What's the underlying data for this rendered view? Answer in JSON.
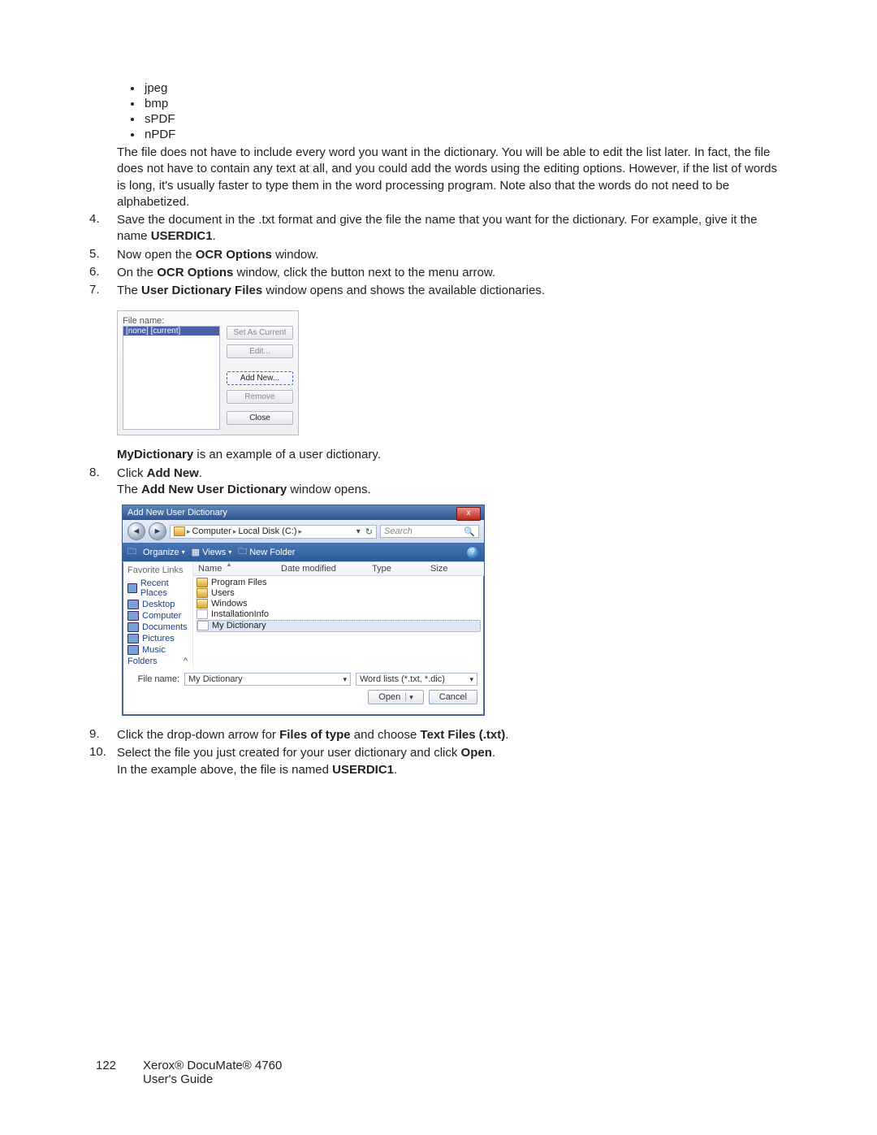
{
  "bullets": {
    "b0": "jpeg",
    "b1": "bmp",
    "b2": "sPDF",
    "b3": "nPDF"
  },
  "para1": "The file does not have to include every word you want in the dictionary. You will be able to edit the list later. In fact, the file does not have to contain any text at all, and you could add the words using the editing options. However, if the list of words is long, it's usually faster to type them in the word processing program. Note also that the words do not need to be alphabetized.",
  "step4_num": "4.",
  "step4_a": "Save the document in the .txt format and give the file the name that you want for the dictionary. For example, give it the name ",
  "step4_b": "USERDIC1",
  "step4_c": ".",
  "step5_num": "5.",
  "step5_a": "Now open the ",
  "step5_b": "OCR Options",
  "step5_c": " window.",
  "step6_num": "6.",
  "step6_a": "On the ",
  "step6_b": "OCR Options",
  "step6_c": " window, click the button next to the menu arrow.",
  "step7_num": "7.",
  "step7_a": "The ",
  "step7_b": "User Dictionary Files",
  "step7_c": " window opens and shows the available dictionaries.",
  "udf": {
    "file_label": "File name:",
    "selected": "[none] [current]",
    "set_current": "Set As Current",
    "edit": "Edit...",
    "add_new": "Add New...",
    "remove": "Remove",
    "close": "Close"
  },
  "my_dict_a": "MyDictionary",
  "my_dict_b": " is an example of a user dictionary.",
  "step8_num": "8.",
  "step8_a": "Click ",
  "step8_b": "Add New",
  "step8_c": ".",
  "step8_d": "The ",
  "step8_e": "Add New User Dictionary",
  "step8_f": " window opens.",
  "anud": {
    "title": "Add New User Dictionary",
    "close_glyph": "x",
    "nav_back": "◄",
    "nav_fwd": "►",
    "bc1": "Computer",
    "bc2": "Local Disk (C:)",
    "bc_sep": "▸",
    "search_ph": "Search",
    "search_glyph": "🔍",
    "organize": "Organize",
    "views": "Views",
    "newfolder": "New Folder",
    "help_glyph": "?",
    "fav_head": "Favorite Links",
    "sb0": "Recent Places",
    "sb1": "Desktop",
    "sb2": "Computer",
    "sb3": "Documents",
    "sb4": "Pictures",
    "sb5": "Music",
    "folders": "Folders",
    "folders_glyph": "^",
    "col_name": "Name",
    "col_date": "Date modified",
    "col_type": "Type",
    "col_size": "Size",
    "f0": "Program Files",
    "f1": "Users",
    "f2": "Windows",
    "f3": "InstallationInfo",
    "f4": "My Dictionary",
    "filename_label": "File name:",
    "filename_value": "My Dictionary",
    "filter_value": "Word lists (*.txt, *.dic)",
    "open": "Open",
    "cancel": "Cancel"
  },
  "step9_num": "9.",
  "step9_a": "Click the drop-down arrow for ",
  "step9_b": "Files of type",
  "step9_c": " and choose ",
  "step9_d": "Text Files (.txt)",
  "step9_e": ".",
  "step10_num": "10.",
  "step10_a": "Select the file you just created for your user dictionary and click ",
  "step10_b": "Open",
  "step10_c": ".",
  "step10_d": "In the example above, the file is named ",
  "step10_e": "USERDIC1",
  "step10_f": ".",
  "footer": {
    "page": "122",
    "prod": "Xerox® DocuMate® 4760",
    "guide": "User's Guide"
  }
}
